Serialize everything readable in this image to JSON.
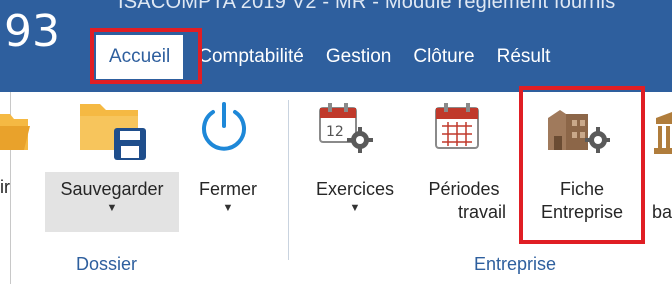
{
  "window": {
    "logo_text": "93",
    "title": "ISACOMPTA 2019 V2 - MR - Module règlement fournis"
  },
  "tabs": [
    {
      "label": "Accueil",
      "active": true
    },
    {
      "label": "Comptabilité",
      "active": false
    },
    {
      "label": "Gestion",
      "active": false
    },
    {
      "label": "Clôture",
      "active": false
    },
    {
      "label": "Résult",
      "active": false
    }
  ],
  "ribbon": {
    "groups": [
      {
        "label": "Dossier",
        "commands": [
          {
            "label": "rir",
            "icon": "folder-open-icon"
          },
          {
            "label": "Sauvegarder",
            "icon": "folder-save-icon",
            "has_dropdown": true,
            "pressed": true
          },
          {
            "label": "Fermer",
            "icon": "power-icon",
            "has_dropdown": true
          }
        ]
      },
      {
        "label": "Entreprise",
        "commands": [
          {
            "label": "Exercices",
            "icon": "calendar-gear-icon",
            "has_dropdown": true
          },
          {
            "label_line1": "Périodes",
            "label_line2": "travail",
            "icon": "calendar-grid-icon"
          },
          {
            "label_line1": "Fiche",
            "label_line2": "Entreprise",
            "icon": "building-gear-icon",
            "highlighted": true
          },
          {
            "label": "ba",
            "icon": "bank-icon"
          }
        ]
      }
    ]
  },
  "colors": {
    "title_bar": "#2e5f9e",
    "highlight_box": "#e01e24",
    "group_label": "#2e5f9e",
    "folder": "#f5b943",
    "calendar_red": "#c0392b",
    "gear": "#5a5a5a"
  }
}
